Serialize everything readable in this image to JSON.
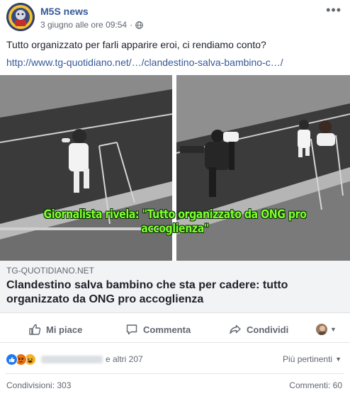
{
  "header": {
    "page_name": "M5S news",
    "date": "3 giugno alle ore 09:54",
    "separator": "·",
    "more_label": "•••"
  },
  "post": {
    "text": "Tutto organizzato per farli apparire eroi, ci rendiamo conto?",
    "link": "http://www.tg-quotidiano.net/…/clandestino-salva-bambino-c…/"
  },
  "image": {
    "caption": "Giornalista rivela: \"Tutto organizzato da ONG pro accoglienza\"",
    "caption_color": "#7dff2f"
  },
  "preview": {
    "domain": "TG-QUOTIDIANO.NET",
    "title": "Clandestino salva bambino che sta per cadere: tutto organizzato da ONG pro accoglienza"
  },
  "actions": {
    "like": "Mi piace",
    "comment": "Comment a",
    "share": "Condividi"
  },
  "reactions": {
    "icons": [
      "like-icon",
      "angry-icon",
      "laugh-icon"
    ],
    "others": "e altri 207",
    "sort_label": "Più pertinenti"
  },
  "stats": {
    "shares": "Condivisioni: 303",
    "comments": "Commenti: 60"
  },
  "colors": {
    "link": "#365899",
    "text": "#1d2129",
    "muted": "#616770",
    "like_blue": "#2078f4"
  }
}
